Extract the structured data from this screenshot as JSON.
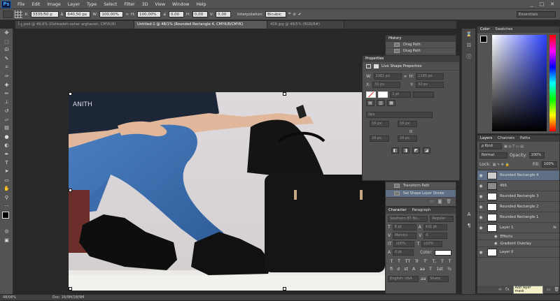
{
  "app": {
    "logo": "Ps"
  },
  "menu": [
    "File",
    "Edit",
    "Image",
    "Layer",
    "Type",
    "Select",
    "Filter",
    "3D",
    "View",
    "Window",
    "Help"
  ],
  "window_controls": {
    "minimize": "_",
    "restore": "□",
    "close": "✕"
  },
  "options_bar": {
    "x_label": "X:",
    "x_value": "3335/50 p",
    "w_label": "W:",
    "w_value": "100,00%",
    "h_label": "H:",
    "h_value": "100,00%",
    "angle_value": "0,00",
    "hskew_label": "H:",
    "hskew_value": "0,00",
    "vskew_label": "V:",
    "vskew_value": "0,00",
    "interp_label": "Interpolation:",
    "interp_value": "Bicubic",
    "workspace_value": "Essentials"
  },
  "tabs": [
    {
      "label": "ع-آ.psd @ 49,6% (Dshkadeh-sahar arghavan, CMYK/8)",
      "active": false
    },
    {
      "label": "Untitled-1 @ 48/1% (Rounded Rectangle 4, CMYK/8/CMYK)",
      "active": true
    },
    {
      "label": "456.jpg @ 49/5% (RGB/8#)",
      "active": false
    }
  ],
  "canvas": {
    "overlay_text": "ANITH"
  },
  "history": {
    "title": "History",
    "items": [
      "Drag Path",
      "Drag Path"
    ],
    "bottom_items": [
      "Transform Path",
      "Set Shape Layer Stroke"
    ]
  },
  "properties": {
    "title": "Properties",
    "subtitle": "Live Shape Properties",
    "w_label": "W:",
    "w_value": "2361 px",
    "h_label": "H:",
    "h_value": "1195 px",
    "x_label": "X:",
    "x_value": "31 px",
    "y_label": "Y:",
    "y_value": "32 px",
    "stroke_value": "3 pt",
    "corner_value": "0px",
    "r1": "16 px",
    "r2": "16 px",
    "r3": "16 px",
    "r4": "16 px"
  },
  "character": {
    "tabs": [
      "Character",
      "Paragraph"
    ],
    "font": "Southern BT Bo...",
    "style": "Regular",
    "size": "8 pt",
    "leading": "431 pt",
    "kerning": "Metrics",
    "tracking": "0",
    "vscale": "100%",
    "hscale": "100%",
    "baseline": "0 pt",
    "color_label": "Color:",
    "glyphs": [
      "T",
      "T",
      "TT",
      "Tr",
      "T'",
      "T,",
      "T",
      "T"
    ],
    "glyphs2": [
      "fi",
      "ơ",
      "st",
      "A",
      "aa",
      "T",
      "1st",
      "½"
    ],
    "language": "English: USA",
    "aa_label": "aa",
    "antialias": "Sharp"
  },
  "color_panel": {
    "tabs": [
      "Color",
      "Swatches"
    ]
  },
  "layers": {
    "tabs": [
      "Layers",
      "Channels",
      "Paths"
    ],
    "kind_label": "ρ Kind",
    "blend_mode": "Normal",
    "opacity_label": "Opacity:",
    "opacity": "100%",
    "lock_label": "Lock:",
    "fill_label": "Fill:",
    "fill": "100%",
    "items": [
      {
        "name": "Rounded Rectangle 4",
        "selected": true
      },
      {
        "name": "456",
        "selected": false
      },
      {
        "name": "Rounded Rectangle 3",
        "selected": false
      },
      {
        "name": "Rounded Rectangle 2",
        "selected": false
      },
      {
        "name": "Rounded Rectangle 1",
        "selected": false
      },
      {
        "name": "Layer 1",
        "selected": false
      }
    ],
    "effects_label": "Effects",
    "effect_item": "Gradient Overlay",
    "layer0": "Layer 0",
    "fx_label": "fx",
    "add_mask_tooltip": "Add layer mask"
  },
  "status": {
    "zoom": "48/06%",
    "doc": "Doc: 16/9M/28/9M"
  },
  "colors": {
    "accent": "#5f6f86",
    "bg": "#282828"
  }
}
